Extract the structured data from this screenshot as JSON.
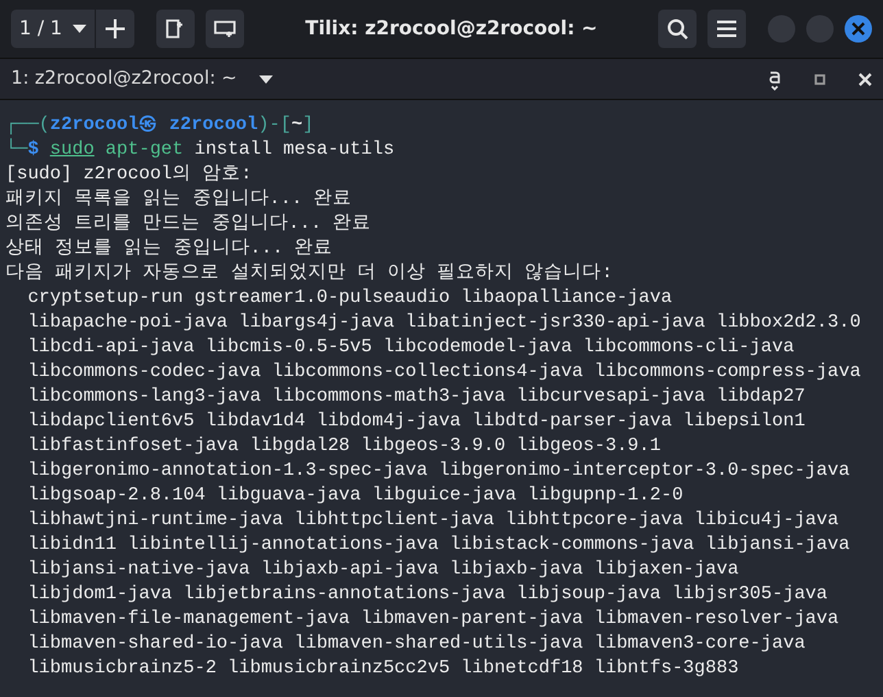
{
  "window": {
    "title": "Tilix: z2rocool@z2rocool: ~",
    "session_selector": "1 / 1"
  },
  "terminal": {
    "title": "1: z2rocool@z2rocool: ~",
    "lines": [
      {
        "kind": "prompt",
        "segments": [
          {
            "text": "┌──(",
            "kind": "frame"
          },
          {
            "text": "z2rocool㉿ z2rocool",
            "kind": "user"
          },
          {
            "text": ")-[",
            "kind": "frame"
          },
          {
            "text": "~",
            "kind": "path"
          },
          {
            "text": "]",
            "kind": "frame"
          }
        ]
      },
      {
        "kind": "prompt",
        "segments": [
          {
            "text": "└─",
            "kind": "frame"
          },
          {
            "text": "$",
            "kind": "user"
          },
          {
            "text": "sudo",
            "kind": "sudo"
          },
          {
            "text": " apt-get",
            "kind": "command"
          },
          {
            "text": " install mesa-utils",
            "kind": "plain"
          }
        ]
      },
      {
        "kind": "output",
        "text": "[sudo] z2rocool의 암호:"
      },
      {
        "kind": "output",
        "text": "패키지 목록을 읽는 중입니다... 완료"
      },
      {
        "kind": "output",
        "text": "의존성 트리를 만드는 중입니다... 완료"
      },
      {
        "kind": "output",
        "text": "상태 정보를 읽는 중입니다... 완료"
      },
      {
        "kind": "output",
        "text": "다음 패키지가 자동으로 설치되었지만 더 이상 필요하지 않습니다:"
      },
      {
        "kind": "output",
        "text": "  cryptsetup-run gstreamer1.0-pulseaudio libaopalliance-java"
      },
      {
        "kind": "output",
        "text": "  libapache-poi-java libargs4j-java libatinject-jsr330-api-java libbox2d2.3.0"
      },
      {
        "kind": "output",
        "text": "  libcdi-api-java libcmis-0.5-5v5 libcodemodel-java libcommons-cli-java"
      },
      {
        "kind": "output",
        "text": "  libcommons-codec-java libcommons-collections4-java libcommons-compress-java"
      },
      {
        "kind": "output",
        "text": "  libcommons-lang3-java libcommons-math3-java libcurvesapi-java libdap27"
      },
      {
        "kind": "output",
        "text": "  libdapclient6v5 libdav1d4 libdom4j-java libdtd-parser-java libepsilon1"
      },
      {
        "kind": "output",
        "text": "  libfastinfoset-java libgdal28 libgeos-3.9.0 libgeos-3.9.1"
      },
      {
        "kind": "output",
        "text": "  libgeronimo-annotation-1.3-spec-java libgeronimo-interceptor-3.0-spec-java"
      },
      {
        "kind": "output",
        "text": "  libgsoap-2.8.104 libguava-java libguice-java libgupnp-1.2-0"
      },
      {
        "kind": "output",
        "text": "  libhawtjni-runtime-java libhttpclient-java libhttpcore-java libicu4j-java"
      },
      {
        "kind": "output",
        "text": "  libidn11 libintellij-annotations-java libistack-commons-java libjansi-java"
      },
      {
        "kind": "output",
        "text": "  libjansi-native-java libjaxb-api-java libjaxb-java libjaxen-java"
      },
      {
        "kind": "output",
        "text": "  libjdom1-java libjetbrains-annotations-java libjsoup-java libjsr305-java"
      },
      {
        "kind": "output",
        "text": "  libmaven-file-management-java libmaven-parent-java libmaven-resolver-java"
      },
      {
        "kind": "output",
        "text": "  libmaven-shared-io-java libmaven-shared-utils-java libmaven3-core-java"
      },
      {
        "kind": "output",
        "text": "  libmusicbrainz5-2 libmusicbrainz5cc2v5 libnetcdf18 libntfs-3g883"
      }
    ]
  }
}
